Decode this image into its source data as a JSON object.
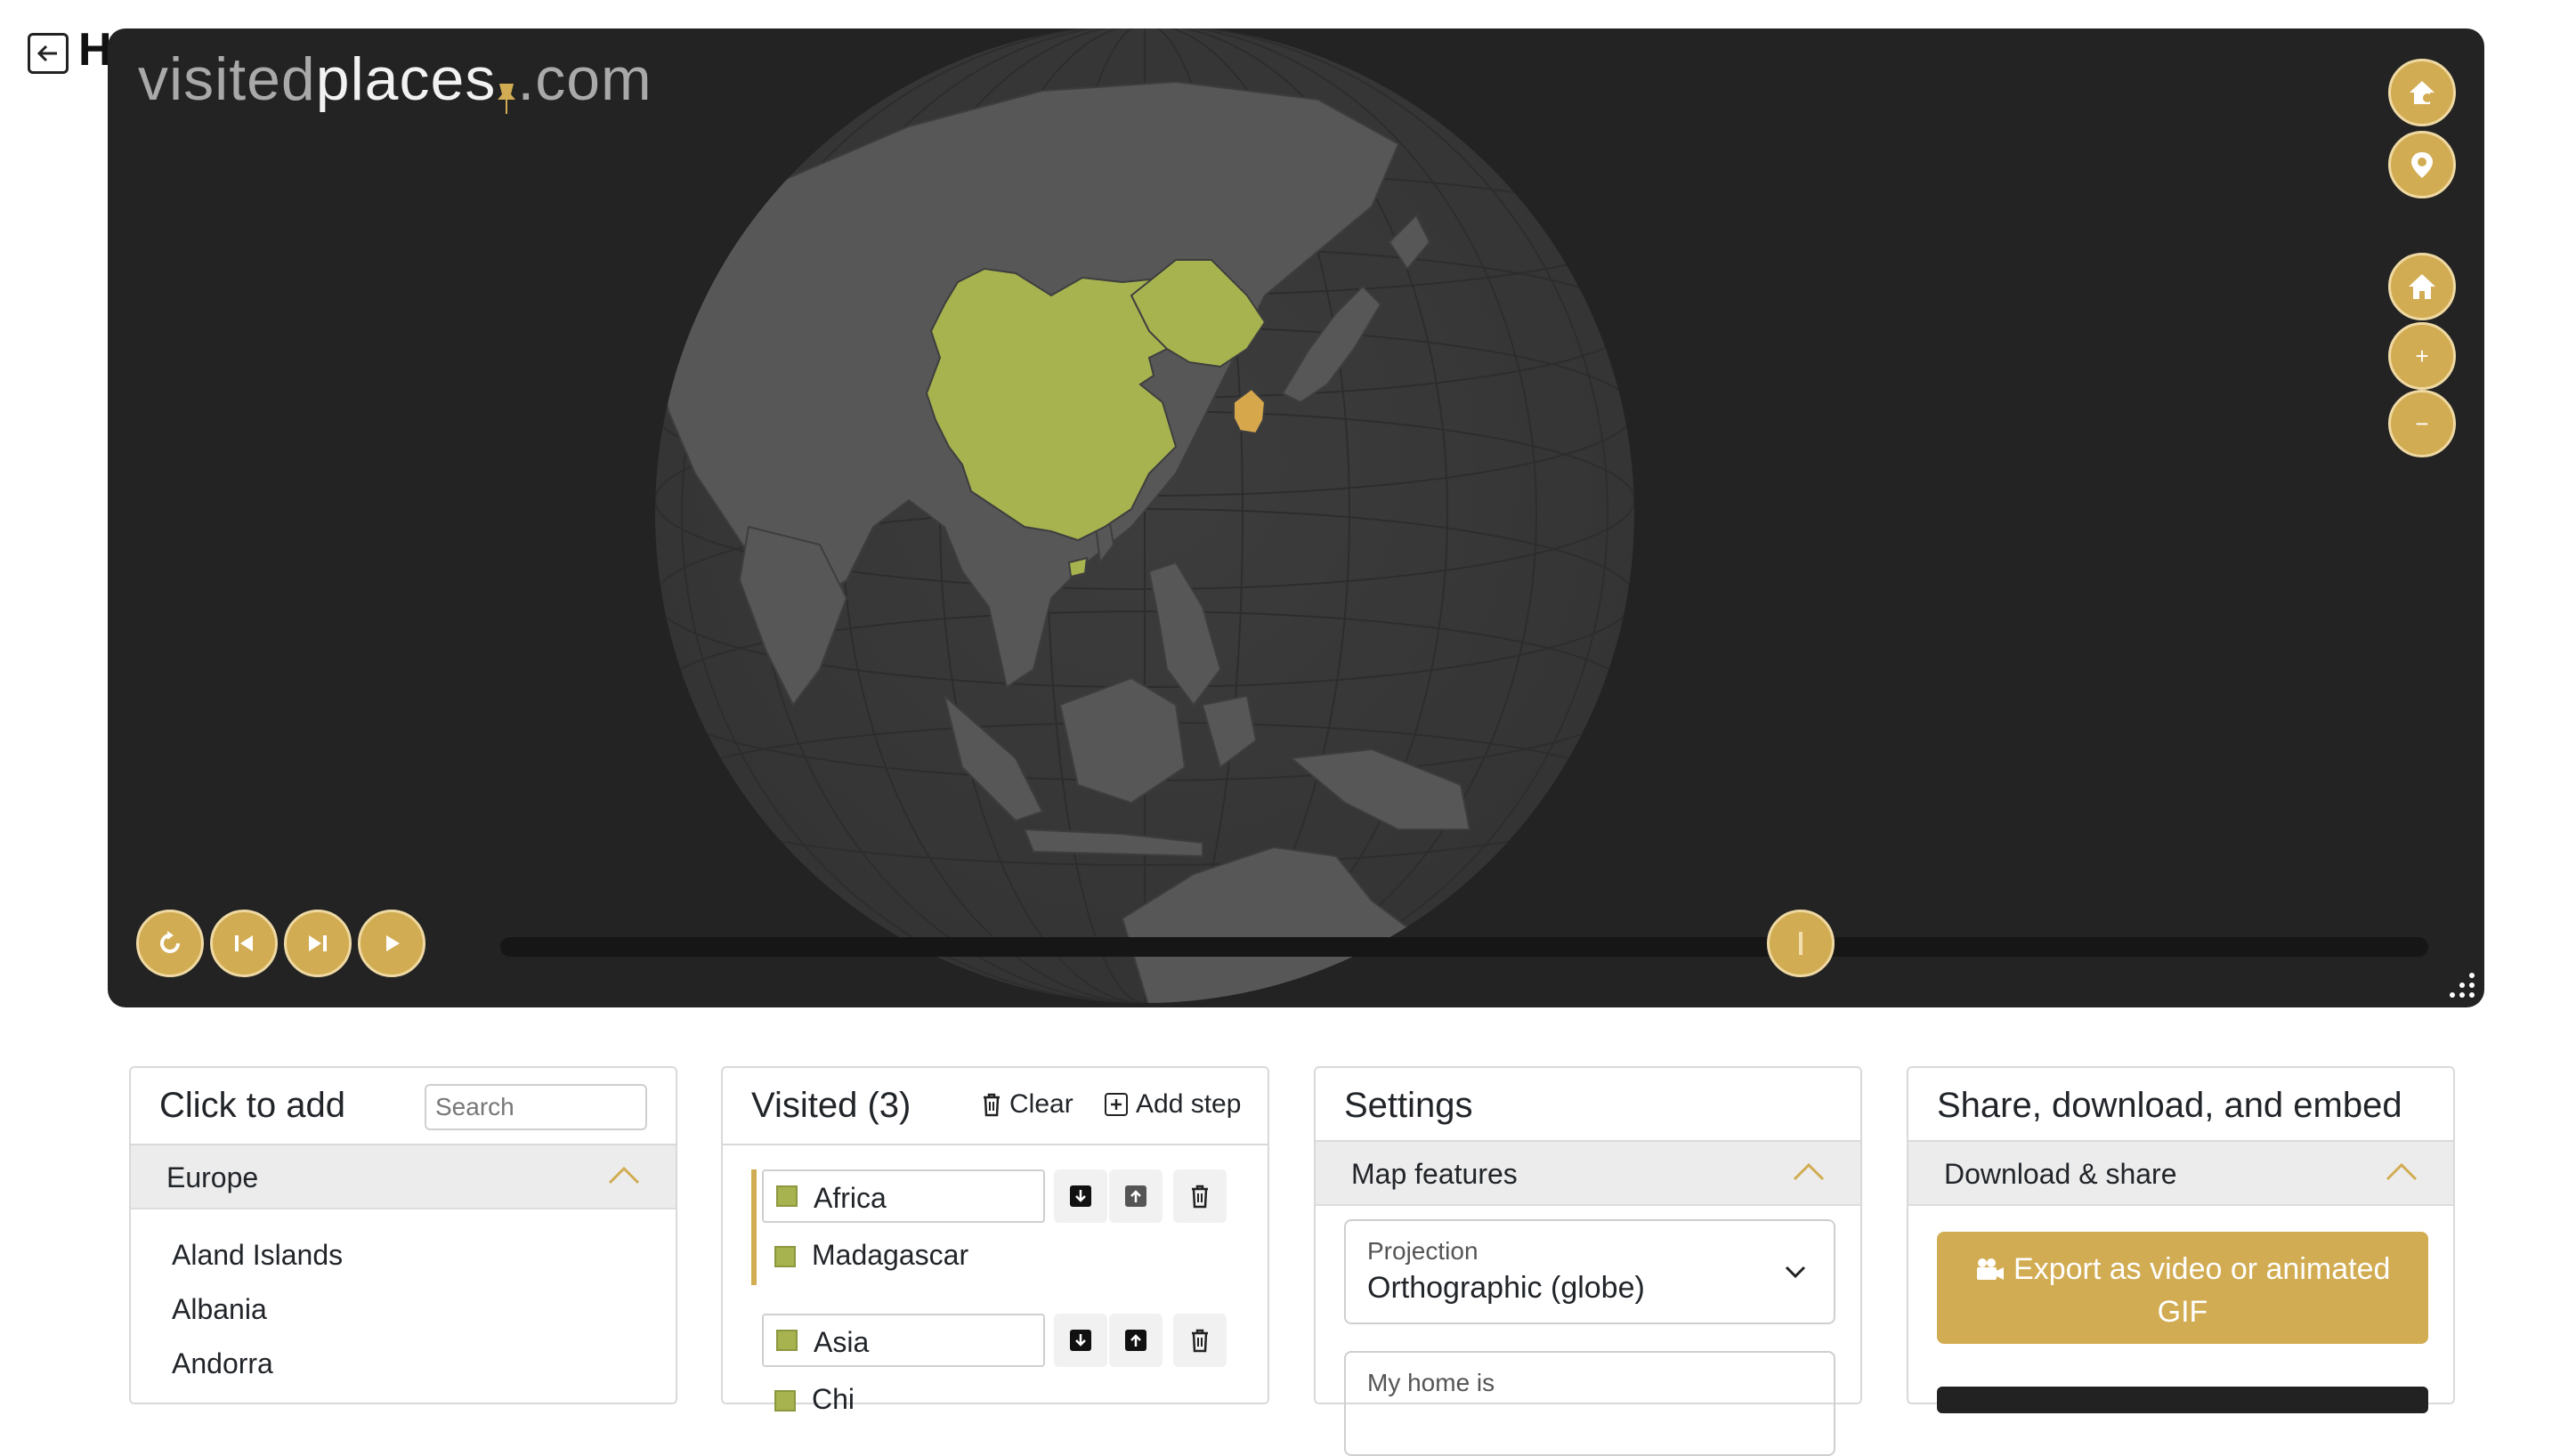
{
  "page": {
    "back_title_fragment": "H"
  },
  "logo": {
    "part1": "visited",
    "part2": "places",
    "part3": ".com"
  },
  "map": {
    "projection_view": "globe centered on East Asia",
    "visited_color": "#a7b34f",
    "highlight_color": "#d7a74c",
    "colors": {
      "panel_bg": "#232323",
      "land": "#575757",
      "ocean": "#3a3a3a",
      "accent": "#d2ac52"
    },
    "side_controls": [
      "home-gear-icon",
      "pin-gear-icon",
      "home-icon",
      "zoom-in-icon",
      "zoom-out-icon"
    ],
    "zoom_in_label": "+",
    "zoom_out_label": "−",
    "playback_buttons": [
      "replay-icon",
      "previous-step-icon",
      "next-step-icon",
      "play-icon"
    ],
    "timeline_position": 0.67
  },
  "click_to_add": {
    "title": "Click to add",
    "search_placeholder": "Search",
    "section": "Europe",
    "countries": [
      "Aland Islands",
      "Albania",
      "Andorra"
    ]
  },
  "visited": {
    "title": "Visited (3)",
    "clear_label": "Clear",
    "add_step_label": "Add step",
    "groups": [
      {
        "name": "Africa",
        "items": [
          "Madagascar"
        ]
      },
      {
        "name": "Asia",
        "items": [
          "Chi"
        ]
      }
    ]
  },
  "settings": {
    "title": "Settings",
    "section": "Map features",
    "projection_label": "Projection",
    "projection_value": "Orthographic (globe)",
    "home_label": "My home is"
  },
  "share": {
    "title": "Share, download, and embed",
    "section": "Download & share",
    "export_label": "Export as video or animated GIF"
  }
}
